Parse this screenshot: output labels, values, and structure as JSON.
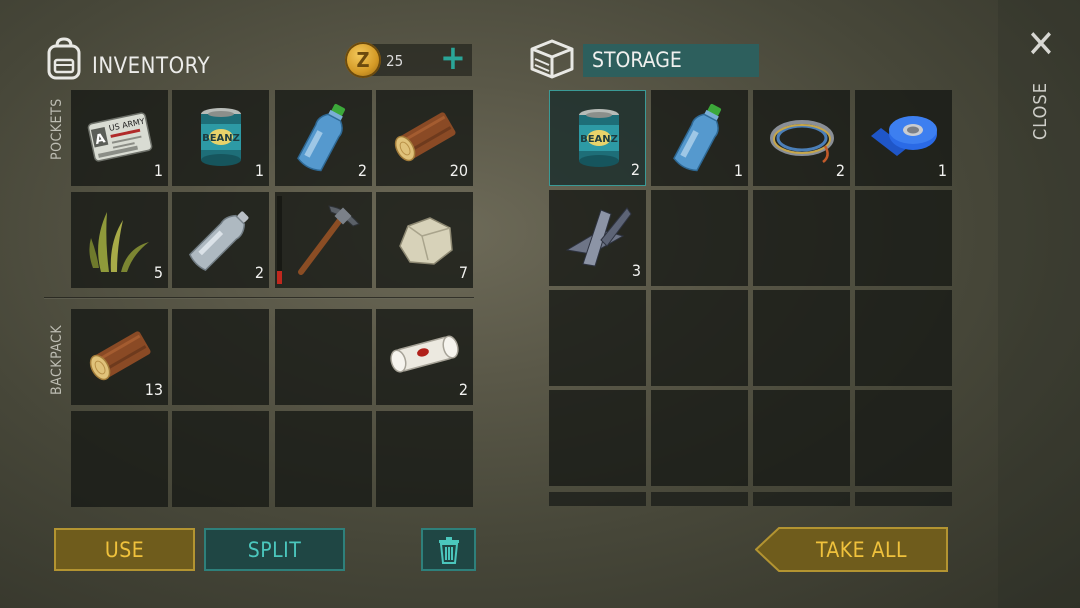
{
  "inventory": {
    "title": "INVENTORY",
    "coins": "25",
    "add_icon": "plus-icon",
    "pockets_label": "POCKETS",
    "backpack_label": "BACKPACK",
    "pockets": [
      {
        "item": "id-card",
        "qty": "1"
      },
      {
        "item": "beanz-can",
        "qty": "1"
      },
      {
        "item": "water-bottle",
        "qty": "2"
      },
      {
        "item": "log",
        "qty": "20"
      },
      {
        "item": "plant-fiber",
        "qty": "5"
      },
      {
        "item": "empty-bottle",
        "qty": "2"
      },
      {
        "item": "pickaxe",
        "qty": "",
        "durability": 0.15
      },
      {
        "item": "stone",
        "qty": "7"
      }
    ],
    "backpack": [
      {
        "item": "log",
        "qty": "13"
      },
      {
        "item": "",
        "qty": ""
      },
      {
        "item": "",
        "qty": ""
      },
      {
        "item": "bandage",
        "qty": "2"
      },
      {
        "item": "",
        "qty": ""
      },
      {
        "item": "",
        "qty": ""
      },
      {
        "item": "",
        "qty": ""
      },
      {
        "item": "",
        "qty": ""
      }
    ],
    "card_text": {
      "line1": "US ARMY",
      "letter": "A"
    },
    "can_text": "BEANZ"
  },
  "storage": {
    "title": "STORAGE",
    "slots": [
      {
        "item": "beanz-can",
        "qty": "2",
        "selected": true
      },
      {
        "item": "water-bottle",
        "qty": "1"
      },
      {
        "item": "wire",
        "qty": "2"
      },
      {
        "item": "tape",
        "qty": "1"
      },
      {
        "item": "scrap-metal",
        "qty": "3"
      }
    ]
  },
  "close_label": "CLOSE",
  "buttons": {
    "use": "USE",
    "split": "SPLIT",
    "trash_icon": "trash-icon",
    "take_all": "TAKE ALL"
  },
  "colors": {
    "accent_teal": "#2e807b",
    "accent_gold": "#b39431",
    "durability_red": "#c0281e"
  }
}
